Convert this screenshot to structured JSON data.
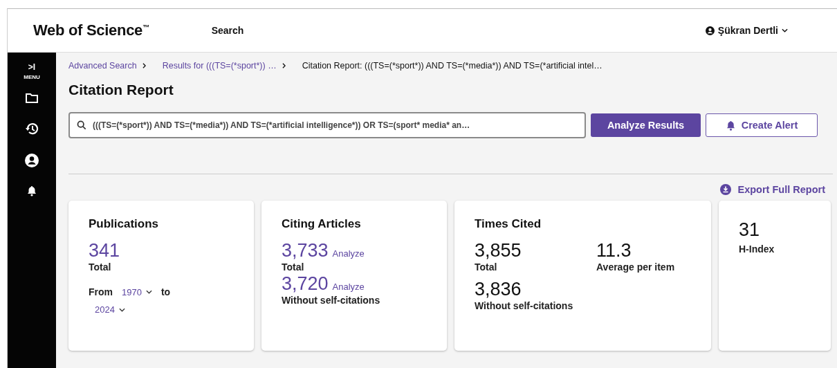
{
  "header": {
    "logo": "Web of Science$^{™}$",
    "nav": "Search",
    "user": "Şükran Dertli"
  },
  "sidebar": {
    "toggle": ">I",
    "menu_label": "MENU",
    "items": [
      {
        "kind": "folder"
      },
      {
        "kind": "history"
      },
      {
        "kind": "account"
      },
      {
        "kind": "bell"
      }
    ]
  },
  "breadcrumbs": [
    {
      "label": "Advanced Search",
      "link": true
    },
    {
      "label": "Results for (((TS=(*sport*)) …",
      "link": true
    },
    {
      "label": "Citation Report: (((TS=(*sport*)) AND TS=(*media*)) AND TS=(*artificial intel…",
      "link": false
    }
  ],
  "title": "Citation Report",
  "query": {
    "value": "(((TS=(*sport*)) AND TS=(*media*)) AND TS=(*artificial intelligence*)) OR TS=(sport* media* an…"
  },
  "buttons": [
    {
      "label": "Analyze Results",
      "kind": "primary"
    },
    {
      "label": "Create Alert",
      "kind": "alert"
    }
  ],
  "export": "Export Full Report",
  "cards": [
    {
      "kind": "publications",
      "title": "Publications",
      "value": "341",
      "label": "Total",
      "from_label": "From",
      "from_value": "1970",
      "to_label": "to",
      "to_value": "2024"
    },
    {
      "kind": "citing",
      "title": "Citing Articles",
      "metrics": [
        {
          "value": "3,733",
          "link": "Analyze",
          "label": "Total"
        },
        {
          "value": "3,720",
          "link": "Analyze",
          "label": "Without self-citations"
        }
      ]
    },
    {
      "kind": "cited",
      "title": "Times Cited",
      "metrics": [
        {
          "value": "3,855",
          "label": "Total"
        },
        {
          "value": "11.3",
          "label": "Average per item"
        },
        {
          "value": "3,836",
          "label": "Without self-citations"
        }
      ]
    },
    {
      "kind": "hindex",
      "value": "31",
      "label": "H-Index"
    }
  ]
}
